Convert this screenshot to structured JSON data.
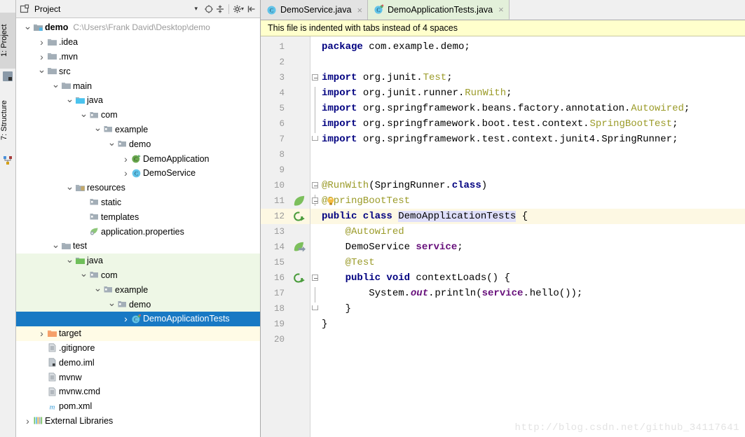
{
  "toolwindows": {
    "left": [
      {
        "label": "1: Project",
        "icon": "project-icon",
        "active": true
      },
      {
        "label": "7: Structure",
        "icon": "structure-icon",
        "active": false
      }
    ]
  },
  "project_panel": {
    "title": "Project",
    "dropdown_caret": "▾",
    "toolbar_icons": [
      {
        "name": "locate-target-icon",
        "glyph": "⊕"
      },
      {
        "name": "collapse-all-icon",
        "glyph": "≡"
      },
      {
        "name": "settings-gear-icon",
        "glyph": "⚙"
      },
      {
        "name": "hide-panel-icon",
        "glyph": "⇤"
      }
    ],
    "tree": [
      {
        "indent": 0,
        "arrow": "down",
        "icon": "module-folder-icon",
        "label": "demo",
        "bold": true,
        "sub": "C:\\Users\\Frank David\\Desktop\\demo",
        "bg": "none"
      },
      {
        "indent": 1,
        "arrow": "right",
        "icon": "folder-icon",
        "label": ".idea",
        "bg": "none"
      },
      {
        "indent": 1,
        "arrow": "right",
        "icon": "folder-icon",
        "label": ".mvn",
        "bg": "none"
      },
      {
        "indent": 1,
        "arrow": "down",
        "icon": "folder-icon",
        "label": "src",
        "bg": "none"
      },
      {
        "indent": 2,
        "arrow": "down",
        "icon": "folder-icon",
        "label": "main",
        "bg": "none"
      },
      {
        "indent": 3,
        "arrow": "down",
        "icon": "source-folder-icon",
        "label": "java",
        "bg": "none"
      },
      {
        "indent": 4,
        "arrow": "down",
        "icon": "package-icon",
        "label": "com",
        "bg": "none"
      },
      {
        "indent": 5,
        "arrow": "down",
        "icon": "package-icon",
        "label": "example",
        "bg": "none"
      },
      {
        "indent": 6,
        "arrow": "down",
        "icon": "package-icon",
        "label": "demo",
        "bg": "none"
      },
      {
        "indent": 7,
        "arrow": "right",
        "icon": "spring-class-icon",
        "label": "DemoApplication",
        "bg": "none"
      },
      {
        "indent": 7,
        "arrow": "right",
        "icon": "class-icon",
        "label": "DemoService",
        "bg": "none"
      },
      {
        "indent": 3,
        "arrow": "down",
        "icon": "resources-folder-icon",
        "label": "resources",
        "bg": "none"
      },
      {
        "indent": 4,
        "arrow": "none",
        "icon": "package-icon",
        "label": "static",
        "bg": "none"
      },
      {
        "indent": 4,
        "arrow": "none",
        "icon": "package-icon",
        "label": "templates",
        "bg": "none"
      },
      {
        "indent": 4,
        "arrow": "none",
        "icon": "spring-properties-icon",
        "label": "application.properties",
        "bg": "none"
      },
      {
        "indent": 2,
        "arrow": "down",
        "icon": "folder-icon",
        "label": "test",
        "bg": "none"
      },
      {
        "indent": 3,
        "arrow": "down",
        "icon": "test-source-folder-icon",
        "label": "java",
        "bg": "green"
      },
      {
        "indent": 4,
        "arrow": "down",
        "icon": "package-icon",
        "label": "com",
        "bg": "green"
      },
      {
        "indent": 5,
        "arrow": "down",
        "icon": "package-icon",
        "label": "example",
        "bg": "green"
      },
      {
        "indent": 6,
        "arrow": "down",
        "icon": "package-icon",
        "label": "demo",
        "bg": "green"
      },
      {
        "indent": 7,
        "arrow": "right",
        "icon": "test-class-icon",
        "label": "DemoApplicationTests",
        "bg": "selected"
      },
      {
        "indent": 1,
        "arrow": "right",
        "icon": "excluded-folder-icon",
        "label": "target",
        "bg": "yellow"
      },
      {
        "indent": 1,
        "arrow": "none",
        "icon": "file-icon",
        "label": ".gitignore",
        "bg": "none"
      },
      {
        "indent": 1,
        "arrow": "none",
        "icon": "iml-file-icon",
        "label": "demo.iml",
        "bg": "none"
      },
      {
        "indent": 1,
        "arrow": "none",
        "icon": "file-icon",
        "label": "mvnw",
        "bg": "none"
      },
      {
        "indent": 1,
        "arrow": "none",
        "icon": "file-icon",
        "label": "mvnw.cmd",
        "bg": "none"
      },
      {
        "indent": 1,
        "arrow": "none",
        "icon": "maven-file-icon",
        "label": "pom.xml",
        "bg": "none"
      },
      {
        "indent": 0,
        "arrow": "right",
        "icon": "libraries-icon",
        "label": "External Libraries",
        "bg": "none"
      }
    ]
  },
  "editor": {
    "tabs": [
      {
        "label": "DemoService.java",
        "icon": "class-icon",
        "active": false,
        "close": "×"
      },
      {
        "label": "DemoApplicationTests.java",
        "icon": "test-class-icon",
        "active": true,
        "close": "×"
      }
    ],
    "notification": "This file is indented with tabs instead of 4 spaces",
    "current_line": 12,
    "watermark": "http://blog.csdn.net/github_34117641",
    "line_numbers": [
      "1",
      "2",
      "3",
      "4",
      "5",
      "6",
      "7",
      "8",
      "9",
      "10",
      "11",
      "12",
      "13",
      "14",
      "15",
      "16",
      "17",
      "18",
      "19",
      "20"
    ],
    "gutter_markers": [
      {
        "line": 11,
        "icon": "spring-bean-leaf-icon"
      },
      {
        "line": 12,
        "icon": "run-test-class-icon"
      },
      {
        "line": 14,
        "icon": "spring-bean-autowired-icon"
      },
      {
        "line": 16,
        "icon": "run-test-method-icon"
      }
    ],
    "code": [
      {
        "n": 1,
        "text": "package com.example.demo;"
      },
      {
        "n": 2,
        "text": ""
      },
      {
        "n": 3,
        "text": "import org.junit.Test;"
      },
      {
        "n": 4,
        "text": "import org.junit.runner.RunWith;"
      },
      {
        "n": 5,
        "text": "import org.springframework.beans.factory.annotation.Autowired;"
      },
      {
        "n": 6,
        "text": "import org.springframework.boot.test.context.SpringBootTest;"
      },
      {
        "n": 7,
        "text": "import org.springframework.test.context.junit4.SpringRunner;"
      },
      {
        "n": 8,
        "text": ""
      },
      {
        "n": 9,
        "text": ""
      },
      {
        "n": 10,
        "text": "@RunWith(SpringRunner.class)"
      },
      {
        "n": 11,
        "text": "@SpringBootTest"
      },
      {
        "n": 12,
        "text": "public class DemoApplicationTests {"
      },
      {
        "n": 13,
        "text": "    @Autowired"
      },
      {
        "n": 14,
        "text": "    DemoService service;"
      },
      {
        "n": 15,
        "text": "    @Test"
      },
      {
        "n": 16,
        "text": "    public void contextLoads() {"
      },
      {
        "n": 17,
        "text": "        System.out.println(service.hello());"
      },
      {
        "n": 18,
        "text": "    }"
      },
      {
        "n": 19,
        "text": "}"
      },
      {
        "n": 20,
        "text": ""
      }
    ]
  },
  "colors": {
    "selection_blue": "#1879c4",
    "test_source_green": "#eef7e6",
    "excluded_yellow": "#fffbe6",
    "notification_yellow": "#ffffcc",
    "current_line": "#fdf8e3",
    "keyword": "#000080",
    "class_name": "#9b9b29",
    "field": "#660e7a",
    "active_tab": "#e3f0da"
  }
}
